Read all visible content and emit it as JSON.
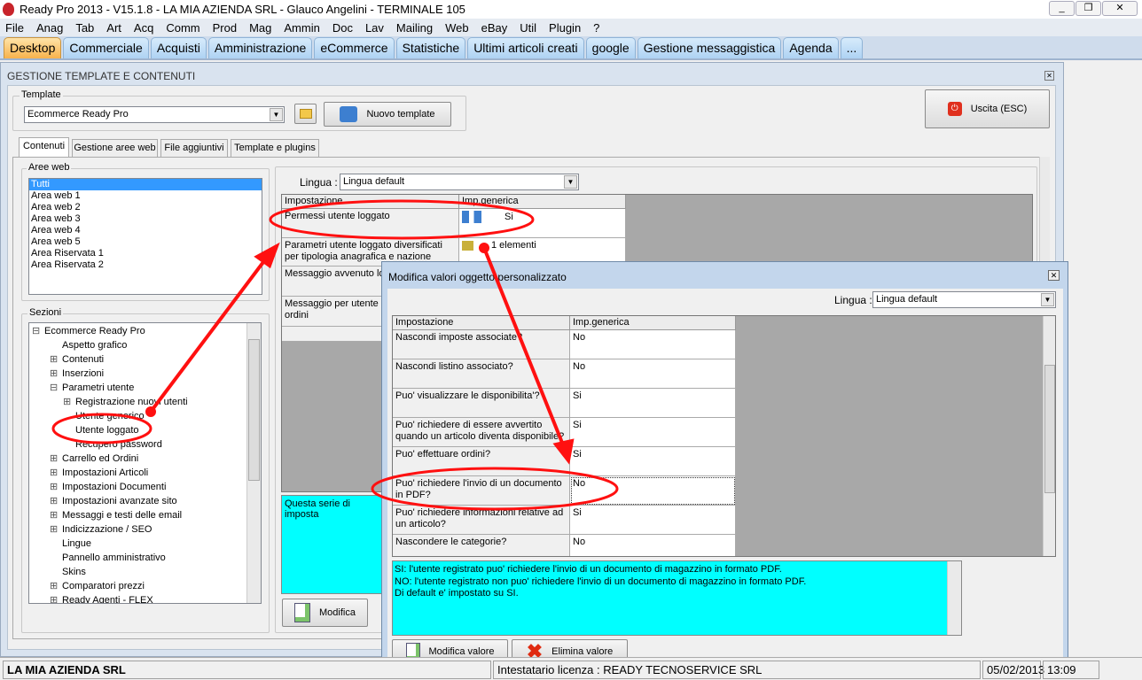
{
  "window": {
    "title": "Ready Pro 2013 - V15.1.8 - LA MIA AZIENDA SRL - Glauco Angelini - TERMINALE 105"
  },
  "menu": [
    "File",
    "Anag",
    "Tab",
    "Art",
    "Acq",
    "Comm",
    "Prod",
    "Mag",
    "Ammin",
    "Doc",
    "Lav",
    "Mailing",
    "Web",
    "eBay",
    "Util",
    "Plugin",
    "?"
  ],
  "tabs": [
    "Desktop",
    "Commerciale",
    "Acquisti",
    "Amministrazione",
    "eCommerce",
    "Statistiche",
    "Ultimi articoli creati",
    "google",
    "Gestione messaggistica",
    "Agenda",
    "..."
  ],
  "panel": {
    "title": "GESTIONE TEMPLATE E CONTENUTI",
    "template_label": "Template",
    "template_value": "Ecommerce Ready Pro",
    "new_template": "Nuovo template",
    "exit": "Uscita (ESC)",
    "subtabs": [
      "Contenuti",
      "Gestione aree web",
      "File aggiuntivi",
      "Template e plugins"
    ],
    "aree_label": "Aree web",
    "aree": [
      "Tutti",
      "Area web 1",
      "Area web 2",
      "Area web 3",
      "Area web 4",
      "Area web 5",
      "Area Riservata 1",
      "Area Riservata 2"
    ],
    "sezioni_label": "Sezioni",
    "tree": [
      {
        "t": "Ecommerce Ready Pro",
        "lvl": 0,
        "exp": "⊟"
      },
      {
        "t": "Aspetto grafico",
        "lvl": 1,
        "exp": ""
      },
      {
        "t": "Contenuti",
        "lvl": 1,
        "exp": "⊞"
      },
      {
        "t": "Inserzioni",
        "lvl": 1,
        "exp": "⊞"
      },
      {
        "t": "Parametri utente",
        "lvl": 1,
        "exp": "⊟"
      },
      {
        "t": "Registrazione nuovi utenti",
        "lvl": 2,
        "exp": "⊞"
      },
      {
        "t": "Utente generico",
        "lvl": 2,
        "exp": ""
      },
      {
        "t": "Utente loggato",
        "lvl": 2,
        "exp": ""
      },
      {
        "t": "Recupero password",
        "lvl": 2,
        "exp": ""
      },
      {
        "t": "Carrello ed Ordini",
        "lvl": 1,
        "exp": "⊞"
      },
      {
        "t": "Impostazioni Articoli",
        "lvl": 1,
        "exp": "⊞"
      },
      {
        "t": "Impostazioni Documenti",
        "lvl": 1,
        "exp": "⊞"
      },
      {
        "t": "Impostazioni avanzate sito",
        "lvl": 1,
        "exp": "⊞"
      },
      {
        "t": "Messaggi e testi delle email",
        "lvl": 1,
        "exp": "⊞"
      },
      {
        "t": "Indicizzazione / SEO",
        "lvl": 1,
        "exp": "⊞"
      },
      {
        "t": "Lingue",
        "lvl": 1,
        "exp": ""
      },
      {
        "t": "Pannello amministrativo",
        "lvl": 1,
        "exp": ""
      },
      {
        "t": "Skins",
        "lvl": 1,
        "exp": ""
      },
      {
        "t": "Comparatori prezzi",
        "lvl": 1,
        "exp": "⊞"
      },
      {
        "t": "Ready Agenti - FLEX",
        "lvl": 1,
        "exp": "⊞"
      }
    ],
    "lingua_label": "Lingua :",
    "lingua_value": "Lingua default",
    "grid_headers": [
      "Impostazione",
      "Imp.generica"
    ],
    "rows": [
      {
        "k": "Permessi utente loggato",
        "v": "Si"
      },
      {
        "k": "Parametri utente loggato diversificati per tipologia anagrafica e nazione",
        "v": "1 elementi"
      },
      {
        "k": "Messaggio avvenuto lo",
        "v": ""
      },
      {
        "k": "Messaggio per utente ( abilitato a fare ordini",
        "v": ""
      }
    ],
    "description": "Questa serie di imposta",
    "modify": "Modifica"
  },
  "dialog": {
    "title": "Modifica valori oggetto personalizzato",
    "lingua_label": "Lingua :",
    "lingua_value": "Lingua default",
    "grid_headers": [
      "Impostazione",
      "Imp.generica"
    ],
    "rows": [
      {
        "k": "Nascondi imposte associate?",
        "v": "No"
      },
      {
        "k": "Nascondi listino associato?",
        "v": "No"
      },
      {
        "k": "Puo' visualizzare le disponibilita'?",
        "v": "Si"
      },
      {
        "k": "Puo' richiedere di essere avvertito quando un articolo diventa disponibile?",
        "v": "Si"
      },
      {
        "k": "Puo' effettuare ordini?",
        "v": "Si"
      },
      {
        "k": "Puo' richiedere l'invio di un documento in PDF?",
        "v": "No"
      },
      {
        "k": "Puo' richiedere informazioni relative ad un articolo?",
        "v": "Si"
      },
      {
        "k": "Nascondere le categorie?",
        "v": "No"
      }
    ],
    "description": [
      "SI: l'utente registrato puo' richiedere l'invio di un documento di magazzino in formato PDF.",
      "NO: l'utente registrato non puo' richiedere l'invio di un documento di magazzino in formato PDF.",
      "Di default e' impostato su SI."
    ],
    "modify_value": "Modifica valore",
    "delete_value": "Elimina valore"
  },
  "status": {
    "company": "LA MIA AZIENDA SRL",
    "license": "Intestatario licenza : READY TECNOSERVICE SRL",
    "date": "05/02/2013",
    "time": "13:09"
  },
  "colors": {
    "highlight": "#00ffff",
    "annotation": "#ff0000",
    "active_tab": "#f7b24c"
  }
}
